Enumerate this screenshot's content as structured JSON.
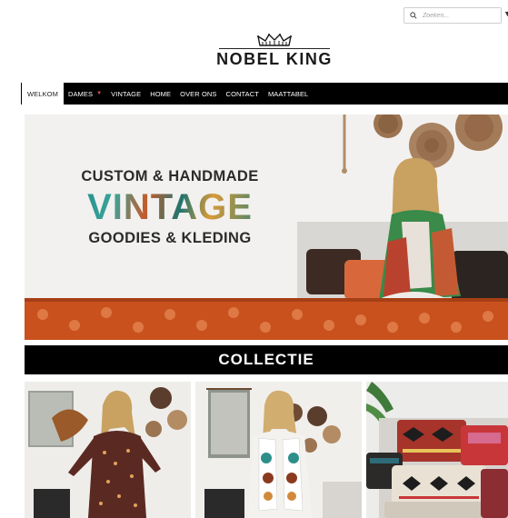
{
  "search": {
    "placeholder": "Zoeken...",
    "icon": "search-icon"
  },
  "brand": {
    "name": "NOBEL KING",
    "logo_icon": "crown-icon"
  },
  "nav": {
    "items": [
      {
        "label": "WELKOM",
        "active": true
      },
      {
        "label": "DAMES",
        "dropdown": true
      },
      {
        "label": "VINTAGE"
      },
      {
        "label": "HOME"
      },
      {
        "label": "OVER ONS"
      },
      {
        "label": "CONTACT"
      },
      {
        "label": "MAATTABEL"
      }
    ],
    "dropdown_caret": "▼"
  },
  "hero": {
    "line1": "CUSTOM & HANDMADE",
    "line2": "VINTAGE",
    "line3": "GOODIES & KLEDING"
  },
  "collection": {
    "title": "COLLECTIE"
  },
  "colors": {
    "nav_bg": "#000000",
    "accent_caret": "#d9534f",
    "hero_teal": "#1e8a8a",
    "sofa_orange": "#c7501f"
  }
}
